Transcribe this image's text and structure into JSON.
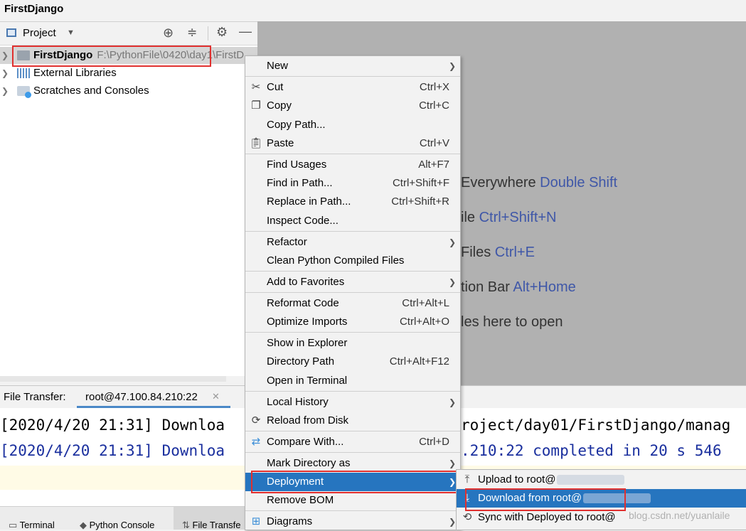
{
  "window": {
    "title": "FirstDjango"
  },
  "project_panel": {
    "header_label": "Project",
    "tree": [
      {
        "label": "FirstDjango",
        "path": "F:\\PythonFile\\0420\\day1\\FirstD"
      },
      {
        "label": "External Libraries"
      },
      {
        "label": "Scratches and Consoles"
      }
    ]
  },
  "editor_hints": [
    {
      "text": "Everywhere ",
      "key": "Double Shift"
    },
    {
      "text": "ile ",
      "key": "Ctrl+Shift+N"
    },
    {
      "text": "Files ",
      "key": "Ctrl+E"
    },
    {
      "text": "tion Bar ",
      "key": "Alt+Home"
    },
    {
      "text": "les here to open",
      "key": ""
    }
  ],
  "file_transfer": {
    "label": "File Transfer:",
    "tab": "root@47.100.84.210:22",
    "log": [
      {
        "left": "[2020/4/20 21:31] Downloa",
        "right": "roject/day01/FirstDjango/manag"
      },
      {
        "left": "[2020/4/20 21:31] Downloa",
        "right": ".210:22 completed in 20 s 546"
      }
    ]
  },
  "bottom_tabs": [
    "Terminal",
    "Python Console",
    "File Transfe"
  ],
  "context_menu": {
    "items": [
      {
        "label": "New",
        "shortcut": "",
        "submenu": true,
        "icon": ""
      },
      {
        "label": "Cut",
        "shortcut": "Ctrl+X",
        "icon": "scissors-icon"
      },
      {
        "label": "Copy",
        "shortcut": "Ctrl+C",
        "icon": "copy-icon"
      },
      {
        "label": "Copy Path...",
        "shortcut": ""
      },
      {
        "label": "Paste",
        "shortcut": "Ctrl+V",
        "icon": "paste-icon"
      },
      {
        "label": "Find Usages",
        "shortcut": "Alt+F7"
      },
      {
        "label": "Find in Path...",
        "shortcut": "Ctrl+Shift+F"
      },
      {
        "label": "Replace in Path...",
        "shortcut": "Ctrl+Shift+R"
      },
      {
        "label": "Inspect Code...",
        "shortcut": ""
      },
      {
        "label": "Refactor",
        "shortcut": "",
        "submenu": true
      },
      {
        "label": "Clean Python Compiled Files",
        "shortcut": ""
      },
      {
        "label": "Add to Favorites",
        "shortcut": "",
        "submenu": true
      },
      {
        "label": "Reformat Code",
        "shortcut": "Ctrl+Alt+L"
      },
      {
        "label": "Optimize Imports",
        "shortcut": "Ctrl+Alt+O"
      },
      {
        "label": "Show in Explorer",
        "shortcut": ""
      },
      {
        "label": "Directory Path",
        "shortcut": "Ctrl+Alt+F12"
      },
      {
        "label": "Open in Terminal",
        "shortcut": ""
      },
      {
        "label": "Local History",
        "shortcut": "",
        "submenu": true
      },
      {
        "label": "Reload from Disk",
        "shortcut": "",
        "icon": "reload-icon"
      },
      {
        "label": "Compare With...",
        "shortcut": "Ctrl+D",
        "icon": "compare-icon"
      },
      {
        "label": "Mark Directory as",
        "shortcut": "",
        "submenu": true
      },
      {
        "label": "Deployment",
        "shortcut": "",
        "submenu": true,
        "selected": true
      },
      {
        "label": "Remove BOM",
        "shortcut": ""
      },
      {
        "label": "Diagrams",
        "shortcut": "",
        "submenu": true,
        "icon": "diagram-icon"
      }
    ]
  },
  "deployment_submenu": [
    {
      "label": "Upload to root@",
      "icon": "upload-icon"
    },
    {
      "label": "Download from root@",
      "icon": "download-icon",
      "selected": true
    },
    {
      "label": "Sync with Deployed to root@",
      "icon": "sync-icon"
    }
  ],
  "watermark": "blog.csdn.net/yuanlaile",
  "colors": {
    "selection": "#2675bf",
    "highlight_box": "#e0302f",
    "shortcut_key": "#3f57a8",
    "editor_bg": "#b1b1b1"
  }
}
